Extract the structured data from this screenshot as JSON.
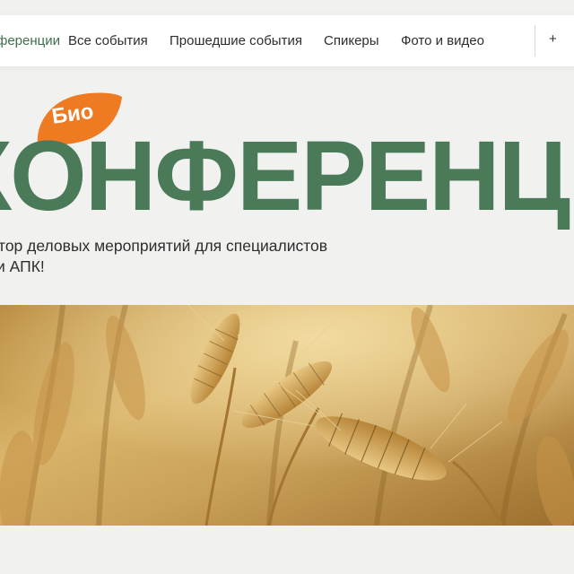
{
  "nav": {
    "items": [
      {
        "label": "ференции",
        "active": true
      },
      {
        "label": "Все события",
        "active": false
      },
      {
        "label": "Прошедшие события",
        "active": false
      },
      {
        "label": "Спикеры",
        "active": false
      },
      {
        "label": "Фото и видео",
        "active": false
      }
    ],
    "edge_icon": "+"
  },
  "hero": {
    "badge": "Био",
    "title": "КОНФЕРЕНЦИИ",
    "subtitle_line1": "тор деловых мероприятий для специалистов",
    "subtitle_line2": "и АПК!"
  },
  "photo": {
    "subject": "wheat-field-photo"
  },
  "colors": {
    "brand_green": "#4a7a58",
    "active_nav": "#3e6e4b",
    "badge_orange": "#ee7a21",
    "background": "#f1f1ef"
  }
}
